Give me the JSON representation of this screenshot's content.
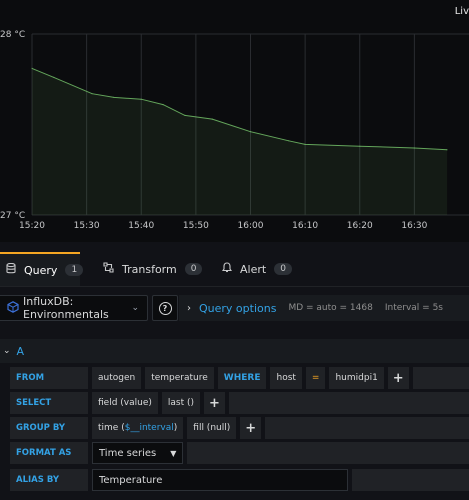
{
  "header": {
    "live_label": "Liv"
  },
  "chart_data": {
    "type": "line",
    "y_ticks": [
      "28 °C",
      "27 °C"
    ],
    "x_ticks": [
      "15:20",
      "15:30",
      "15:40",
      "15:50",
      "16:00",
      "16:10",
      "16:20",
      "16:30"
    ],
    "ylim": [
      27,
      28
    ],
    "x": [
      "15:20",
      "15:24",
      "15:31",
      "15:35",
      "15:40",
      "15:44",
      "15:48",
      "15:53",
      "16:00",
      "16:07",
      "16:10",
      "16:20",
      "16:30",
      "16:36"
    ],
    "series": [
      {
        "values": [
          27.81,
          27.76,
          27.67,
          27.65,
          27.64,
          27.61,
          27.55,
          27.53,
          27.46,
          27.41,
          27.39,
          27.38,
          27.37,
          27.36
        ]
      }
    ],
    "grid": true,
    "color": "#73bf69"
  },
  "tabs": [
    {
      "label": "Query",
      "count": "1",
      "icon": "database-icon"
    },
    {
      "label": "Transform",
      "count": "0",
      "icon": "transform-icon"
    },
    {
      "label": "Alert",
      "count": "0",
      "icon": "bell-icon"
    }
  ],
  "query_options": {
    "datasource": "InfluxDB: Environmentals",
    "label": "Query options",
    "md": "MD = auto = 1468",
    "interval": "Interval = 5s"
  },
  "query": {
    "ref": "A",
    "from_kw": "FROM",
    "from": {
      "policy": "autogen",
      "measurement": "temperature",
      "where_kw": "WHERE",
      "tag": "host",
      "op": "=",
      "value": "humidpi1"
    },
    "select_kw": "SELECT",
    "select": {
      "field": "field (value)",
      "agg": "last ()"
    },
    "group_kw": "GROUP BY",
    "group": {
      "time_prefix": "time (",
      "time_var": "$__interval",
      "time_suffix": ")",
      "fill": "fill (null)"
    },
    "format_kw": "FORMAT AS",
    "format_value": "Time series",
    "alias_kw": "ALIAS BY",
    "alias_value": "Temperature"
  }
}
